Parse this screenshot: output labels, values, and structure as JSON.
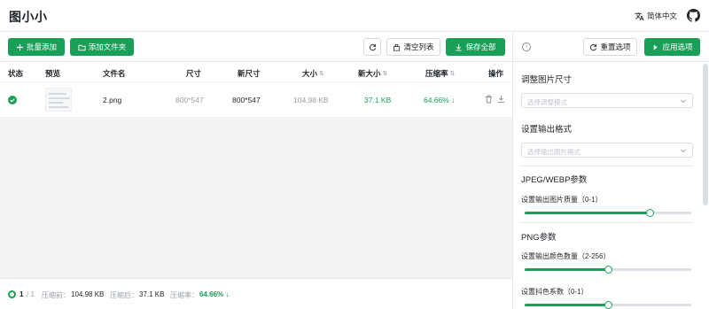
{
  "app": {
    "title": "图小小",
    "language": "简体中文"
  },
  "toolbar": {
    "batch_add": "批量添加",
    "add_folder": "添加文件夹",
    "clear_list": "清空列表",
    "save_all": "保存全部"
  },
  "table": {
    "headers": [
      "状态",
      "预览",
      "文件名",
      "尺寸",
      "新尺寸",
      "大小",
      "新大小",
      "压缩率",
      "操作"
    ],
    "rows": [
      {
        "status": "done",
        "filename": "2.png",
        "size": "800*547",
        "new_size": "800*547",
        "file_size": "104.98 KB",
        "new_file_size": "37.1 KB",
        "compression_rate": "64.66% ↓"
      }
    ]
  },
  "footer": {
    "page_current": "1",
    "page_total": "/ 1",
    "before_label": "压缩前：",
    "before_value": "104.98 KB",
    "after_label": "压缩后：",
    "after_value": "37.1 KB",
    "rate_label": "压缩率：",
    "rate_value": "64.66% ↓"
  },
  "settings": {
    "reset": "重置选项",
    "apply": "应用选项",
    "resize_title": "调整图片尺寸",
    "resize_placeholder": "选择调整模式",
    "format_title": "设置输出格式",
    "format_placeholder": "选择输出图片格式",
    "jpeg_title": "JPEG/WEBP参数",
    "quality_label": "设置输出图片质量（0-1）",
    "quality_value": 0.75,
    "png_title": "PNG参数",
    "colors_label": "设置输出颜色数量（2-256）",
    "colors_value": 0.5,
    "dither_label": "设置抖色系数（0-1）",
    "dither_value": 0.5
  },
  "colors": {
    "accent": "#18a058",
    "text": "#1f2329",
    "muted": "#8a8f99"
  }
}
